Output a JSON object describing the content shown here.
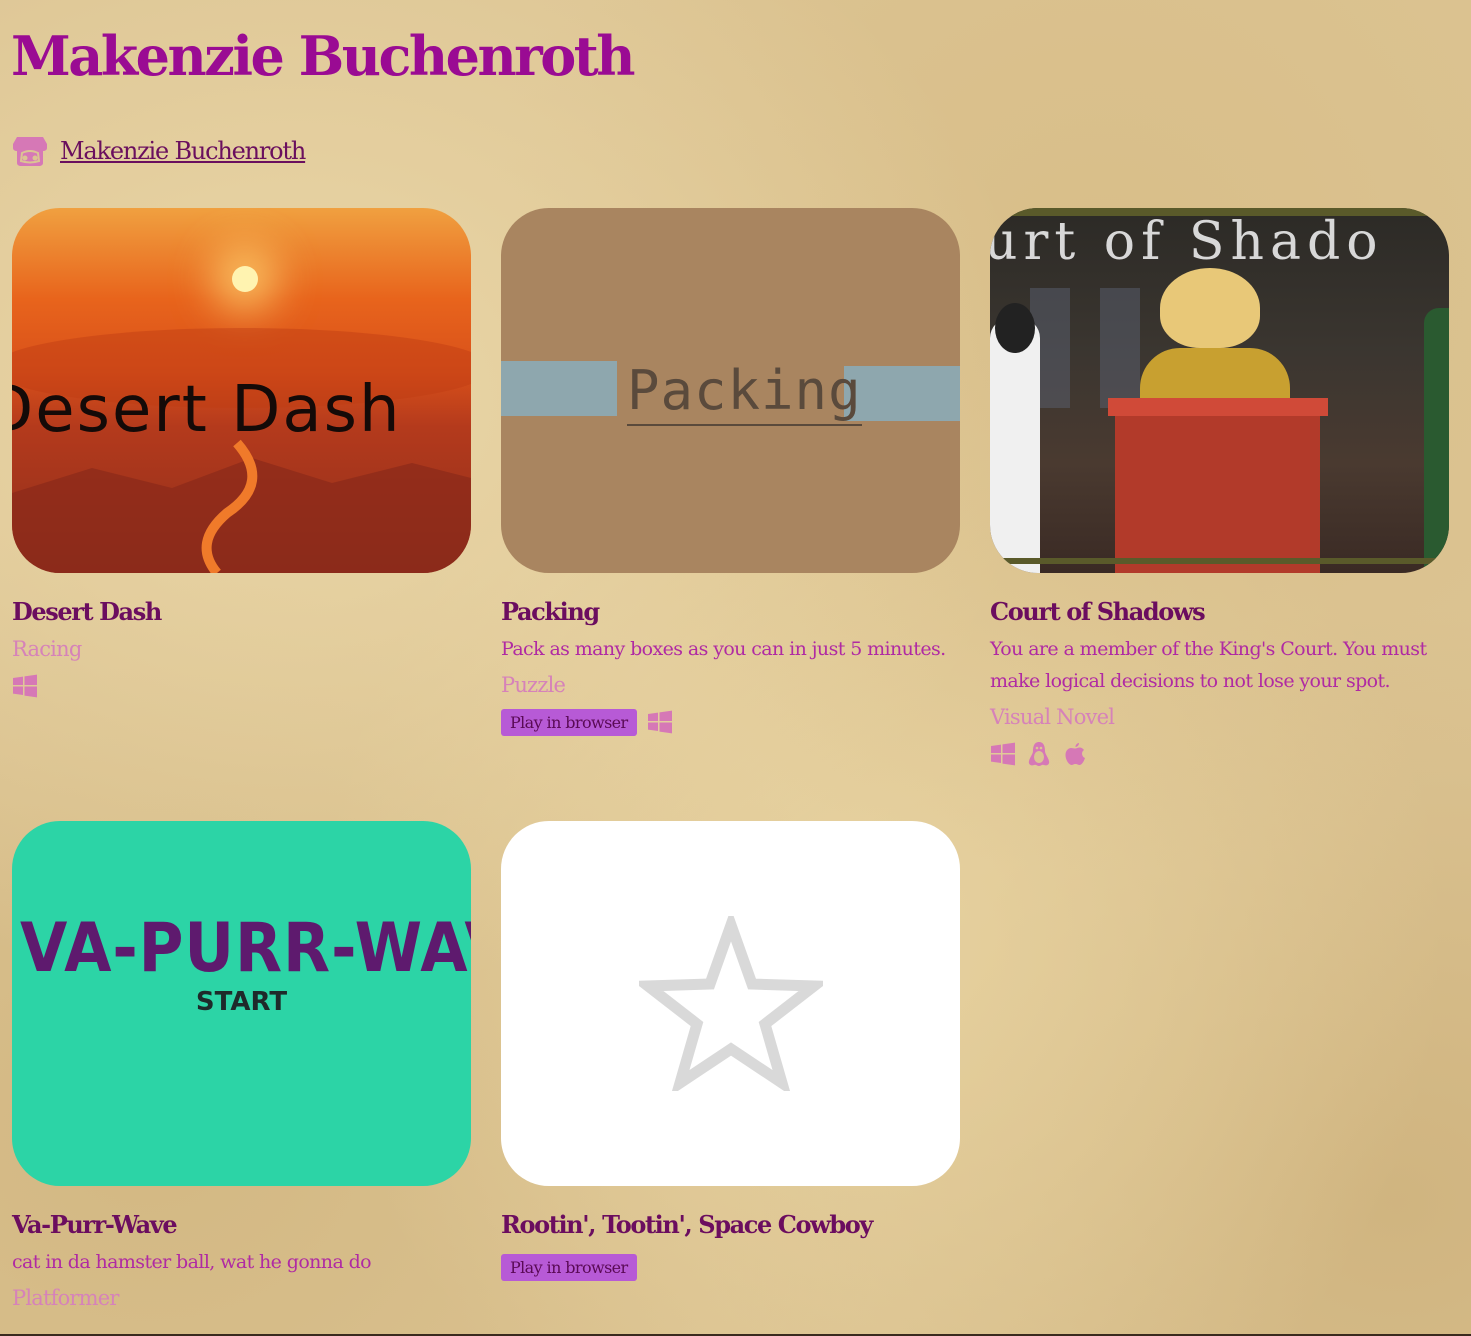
{
  "header": {
    "title": "Makenzie Buchenroth",
    "profile_link": "Makenzie Buchenroth",
    "profile_icon": "itch-io-icon"
  },
  "games": [
    {
      "title": "Desert Dash",
      "description": "",
      "genre": "Racing",
      "play_in_browser": "",
      "platforms": [
        "windows-icon"
      ],
      "thumb_text": "Desert Dash"
    },
    {
      "title": "Packing",
      "description": "Pack as many boxes as you can in just 5 minutes.",
      "genre": "Puzzle",
      "play_in_browser": "Play in browser",
      "platforms": [
        "windows-icon"
      ],
      "thumb_text": "Packing"
    },
    {
      "title": "Court of Shadows",
      "description": "You are a member of the King's Court. You must make logical decisions to not lose your spot.",
      "genre": "Visual Novel",
      "play_in_browser": "",
      "platforms": [
        "windows-icon",
        "linux-icon",
        "apple-icon"
      ],
      "thumb_text": "urt of Shado"
    },
    {
      "title": "Va-Purr-Wave",
      "description": "cat in da hamster ball, wat he gonna do",
      "genre": "Platformer",
      "play_in_browser": "",
      "platforms": [],
      "thumb_text": "VA-PURR-WAVE",
      "thumb_subtext": "START"
    },
    {
      "title": "Rootin', Tootin', Space Cowboy",
      "description": "",
      "genre": "",
      "play_in_browser": "Play in browser",
      "platforms": [],
      "thumb_icon": "star-icon"
    }
  ],
  "colors": {
    "title": "#9a0b93",
    "link": "#6a0f5e",
    "genre": "#d682b9",
    "badge": "#b75ad6",
    "platform_icon": "#d678b6"
  }
}
